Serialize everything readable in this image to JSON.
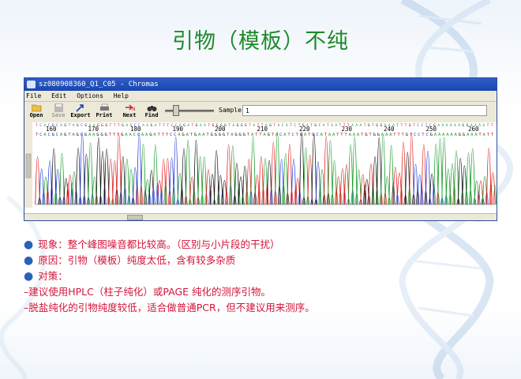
{
  "slide": {
    "title": "引物（模板）不纯",
    "notes": [
      {
        "kind": "bullet",
        "text": "现象：整个峰图噪音都比较高。（区别与小片段的干扰）"
      },
      {
        "kind": "bullet",
        "text": "原因：引物（模板）纯度太低，含有较多杂质"
      },
      {
        "kind": "bullet",
        "text": "对策："
      },
      {
        "kind": "dash",
        "text": "–建议使用HPLC（柱子纯化）或PAGE 纯化的测序引物。"
      },
      {
        "kind": "dash",
        "text": "–脱盐纯化的引物纯度较低，适合做普通PCR，但不建议用来测序。"
      }
    ]
  },
  "window": {
    "title": "sz080908360_Q1_C05 - Chromas",
    "menu": [
      "File",
      "Edit",
      "Options",
      "Help"
    ],
    "toolbar": {
      "open": "Open",
      "save": "Save",
      "export": "Export",
      "print": "Print",
      "next": "Next",
      "find": "Find",
      "sample_label": "Sample:",
      "sample_value": "1"
    },
    "sequence": {
      "top_row": "TCACGCAGTAGCGAAGGGTTTGAACCAAGATTTCCAGATGAATGGGGTAGGGTATTAGTACATCTGATGCATAATTTAAATGTGGAAATTTGTCCTCGAAAAAAGGAAAATT",
      "bottom_row": "TCACGCAGTAGCGAAGGGTTTGAACCAAGATTTCCAGATGAATGGGGTAGGGTATTAGTACATCTGATGCATAATTTAAATGTGGAAATTTGTCCTCGAAAAAAGGAAATATT",
      "positions": [
        "160",
        "170",
        "180",
        "190",
        "200",
        "210",
        "220",
        "230",
        "240",
        "250",
        "260"
      ]
    }
  },
  "colors": {
    "title": "#1d8a2a",
    "notes": "#d3143a",
    "bullet": "#2b61b8",
    "A": "#1a9c2a",
    "C": "#2a3fd8",
    "G": "#111111",
    "T": "#e02020"
  }
}
